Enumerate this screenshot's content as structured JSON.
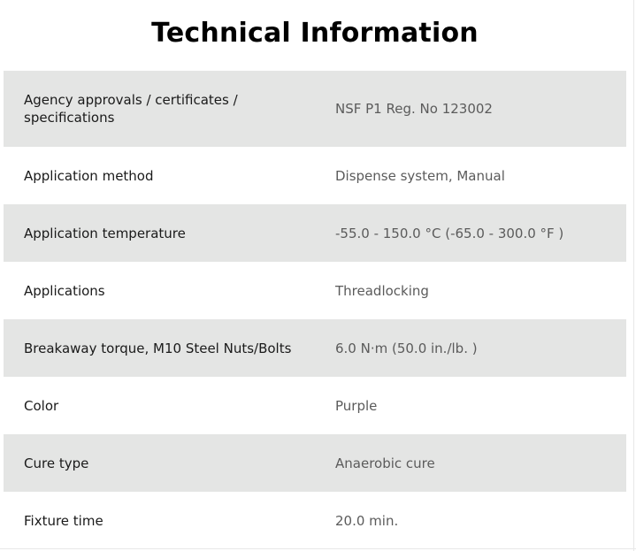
{
  "title": "Technical Information",
  "rows": [
    {
      "label": "Agency approvals / certificates / specifications",
      "value": "NSF P1 Reg. No 123002"
    },
    {
      "label": "Application method",
      "value": "Dispense system, Manual"
    },
    {
      "label": "Application temperature",
      "value": "-55.0 - 150.0 °C (-65.0 - 300.0 °F )"
    },
    {
      "label": "Applications",
      "value": "Threadlocking"
    },
    {
      "label": "Breakaway torque, M10 Steel Nuts/Bolts",
      "value": "6.0 N·m (50.0 in./lb. )"
    },
    {
      "label": "Color",
      "value": "Purple"
    },
    {
      "label": "Cure type",
      "value": "Anaerobic cure"
    },
    {
      "label": "Fixture time",
      "value": "20.0 min."
    }
  ],
  "colors": {
    "row_shade": "#e4e5e4",
    "label_text": "#1a1a1a",
    "value_text": "#5b5b5b"
  }
}
